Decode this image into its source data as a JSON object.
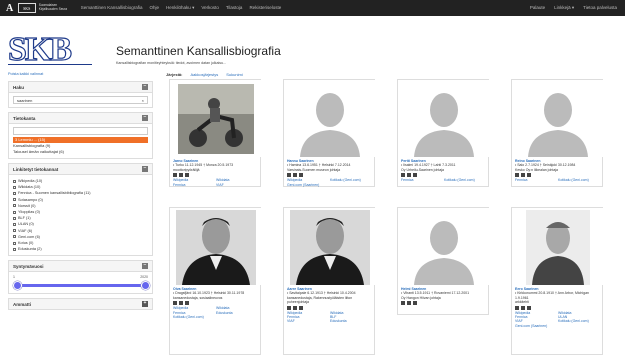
{
  "topbar": {
    "logo_a": "A",
    "logo_box": "SKS",
    "logo_sub": "Suomalaisen Kirjallisuuden Seura",
    "nav": [
      "Semanttinen Kansallisbiografia",
      "Ohje",
      "Henkilöhaku ▾",
      "Verkosto",
      "Tilastoja",
      "Rekisteriseloste"
    ],
    "right": [
      "Palaute",
      "Linkkejä ▾",
      "Tietoa palvelusta"
    ]
  },
  "header": {
    "logo": "SKB",
    "title": "Semanttinen Kansallisbiografia",
    "subtitle": "Kansallisbiografian monitieyhteyksiä: tiedot, avoimen datan julkaisu...",
    "back_link": "Poista kaikki valinnat"
  },
  "sidebar": {
    "search": {
      "title": "Haku",
      "value": "saarinen",
      "clear": "×",
      "collapse": "−"
    },
    "sources": {
      "title": "Tietokanta",
      "items": [
        "3 Lemmiu ... (15)",
        "Kansallisbiografia (9)",
        "Talousel ämän vaikuttajat (6)"
      ],
      "collapse": "−"
    },
    "linked": {
      "title": "Linkitetyt tietokannat",
      "items": [
        "Wikipedia (10)",
        "Wikidata (10)",
        "Fennica - Suomen kansallisbibliografia (11)",
        "Sotasampo (0)",
        "Norssit (0)",
        "Ylioppilas (0)",
        "BLF (1)",
        "ULAN (0)",
        "VIAF (6)",
        "Geni.com (6)",
        "Kotus (0)",
        "Eduskunta (2)"
      ],
      "collapse": "−"
    },
    "years": {
      "title": "Syntymävuosi",
      "min": "1",
      "max": "2020",
      "low_frac": 0.0,
      "high_frac": 1.0,
      "collapse": "−"
    },
    "other": {
      "title": "Ammatti",
      "expand": "+"
    }
  },
  "results": {
    "label": "Järjestä:",
    "sort1": "Aakkosjärjestys",
    "sort2": "Sukunimi",
    "cards": [
      {
        "name": "Jarno Saarinen",
        "dates": "• Turku 11.12.1945 † Monza 20.5.1973",
        "desc": "moottoripyöräilijä",
        "links": [
          "Wikipedia",
          "Wikidata",
          "Fennica",
          "VIAF"
        ]
      },
      {
        "name": "Hannu Saarinen",
        "dates": "• Hamina 13.6.1951 † Helsinki 7.12.2014",
        "desc": "Varsinais-Suomen museon johtaja",
        "links": [
          "Wikipedia",
          "Kotikalu (Geni.com)",
          "Geni.com (Saarinen)"
        ]
      },
      {
        "name": "Pertti Saarinen",
        "dates": "• Iisalmi 19.4.1927 † Lahti 7.3.2011",
        "desc": "Oy Urheilu-Saarinen johtaja",
        "links": [
          "Fennica",
          "Kotikalu (Geni.com)"
        ]
      },
      {
        "name": "Reino Saarinen",
        "dates": "• Salo 2.7.1924 † Seinäjoki 30.12.1984",
        "desc": "Kesko Oy:n liikealan johtaja",
        "links": [
          "Fennica",
          "Kotikalu (Geni.com)"
        ]
      },
      {
        "name": "Oiva Saarinen",
        "dates": "• Dragsfjärd 16.10.1923 † Helsinki 30.11.1978",
        "desc": "kansanedustaja, sosiaalineuvos",
        "links": [
          "Wikipedia",
          "Wikidata",
          "Fennica",
          "Eduskunta",
          "Kotikalu (Geni.com)"
        ]
      },
      {
        "name": "Aarre Saarinen",
        "dates": "• Savitaipale 6.12.1913 † Helsinki 10.4.2004",
        "desc": "kansanedustaja, Rakennustyöläisten liiton puheenjohtaja",
        "links": [
          "Wikipedia",
          "Wikidata",
          "Fennica",
          "BLF",
          "VIAF",
          "Eduskunta"
        ]
      },
      {
        "name": "Helmi Saarinen",
        "dates": "• Vihanti 13.5.1911 † Rovaniemi 17.12.2001",
        "desc": "Oy Hangon Hiivan johtaja",
        "links": []
      },
      {
        "name": "Eero Saarinen",
        "dates": "• Kirkkonummi 20.8.1910 † Ann Arbor, Michigan 1.9.1961",
        "desc": "arkkitehti",
        "links": [
          "Wikipedia",
          "Wikidata",
          "Fennica",
          "ULAN",
          "VIAF",
          "Kotikalu (Geni.com)",
          "Geni.com (Saarinen)"
        ]
      }
    ]
  }
}
